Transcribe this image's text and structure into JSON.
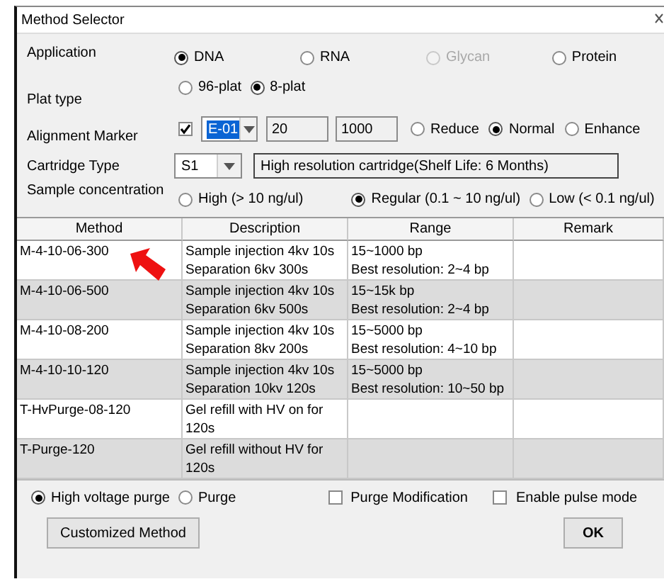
{
  "window": {
    "title": "Method Selector"
  },
  "application": {
    "label": "Application",
    "options": [
      {
        "label": "DNA",
        "selected": true,
        "disabled": false
      },
      {
        "label": "RNA",
        "selected": false,
        "disabled": false
      },
      {
        "label": "Glycan",
        "selected": false,
        "disabled": true
      },
      {
        "label": "Protein",
        "selected": false,
        "disabled": false
      }
    ]
  },
  "plat_type": {
    "label": "Plat type",
    "options": [
      {
        "label": "96-plat",
        "selected": false
      },
      {
        "label": "8-plat",
        "selected": true
      }
    ]
  },
  "alignment_marker": {
    "label": "Alignment Marker",
    "checked": true,
    "marker": "E-01",
    "fields": [
      "20",
      "1000"
    ],
    "options": [
      {
        "label": "Reduce",
        "selected": false
      },
      {
        "label": "Normal",
        "selected": true
      },
      {
        "label": "Enhance",
        "selected": false
      }
    ]
  },
  "cartridge_type": {
    "label": "Cartridge Type",
    "value": "S1",
    "description": "High resolution cartridge(Shelf Life: 6 Months)"
  },
  "sample_concentration": {
    "label": "Sample concentration",
    "options": [
      {
        "label": "High (> 10 ng/ul)",
        "selected": false
      },
      {
        "label": "Regular (0.1 ~ 10 ng/ul)",
        "selected": true
      },
      {
        "label": "Low (< 0.1 ng/ul)",
        "selected": false
      }
    ]
  },
  "table": {
    "columns": [
      "Method",
      "Description",
      "Range",
      "Remark"
    ],
    "rows": [
      {
        "method": "M-4-10-06-300",
        "description": [
          "Sample injection 4kv 10s",
          "Separation 6kv 300s"
        ],
        "range": [
          "15~1000 bp",
          "Best resolution: 2~4 bp"
        ]
      },
      {
        "method": "M-4-10-06-500",
        "description": [
          "Sample injection 4kv 10s",
          "Separation 6kv 500s"
        ],
        "range": [
          "15~15k bp",
          "Best resolution: 2~4 bp"
        ]
      },
      {
        "method": "M-4-10-08-200",
        "description": [
          "Sample injection 4kv 10s",
          "Separation 8kv 200s"
        ],
        "range": [
          "15~5000 bp",
          "Best resolution: 4~10 bp"
        ]
      },
      {
        "method": "M-4-10-10-120",
        "description": [
          "Sample injection 4kv 10s",
          "Separation 10kv 120s"
        ],
        "range": [
          "15~5000 bp",
          "Best resolution: 10~50 bp"
        ]
      },
      {
        "method": "T-HvPurge-08-120",
        "description": [
          "Gel refill with HV on for 120s"
        ],
        "range": []
      },
      {
        "method": "T-Purge-120",
        "description": [
          "Gel refill without HV for 120s"
        ],
        "range": []
      }
    ]
  },
  "purge_options": [
    {
      "label": "High voltage purge",
      "selected": true
    },
    {
      "label": "Purge",
      "selected": false
    }
  ],
  "checkboxes": [
    {
      "label": "Purge Modification",
      "checked": false
    },
    {
      "label": "Enable pulse mode",
      "checked": false
    }
  ],
  "buttons": {
    "customized": "Customized Method",
    "ok": "OK"
  }
}
